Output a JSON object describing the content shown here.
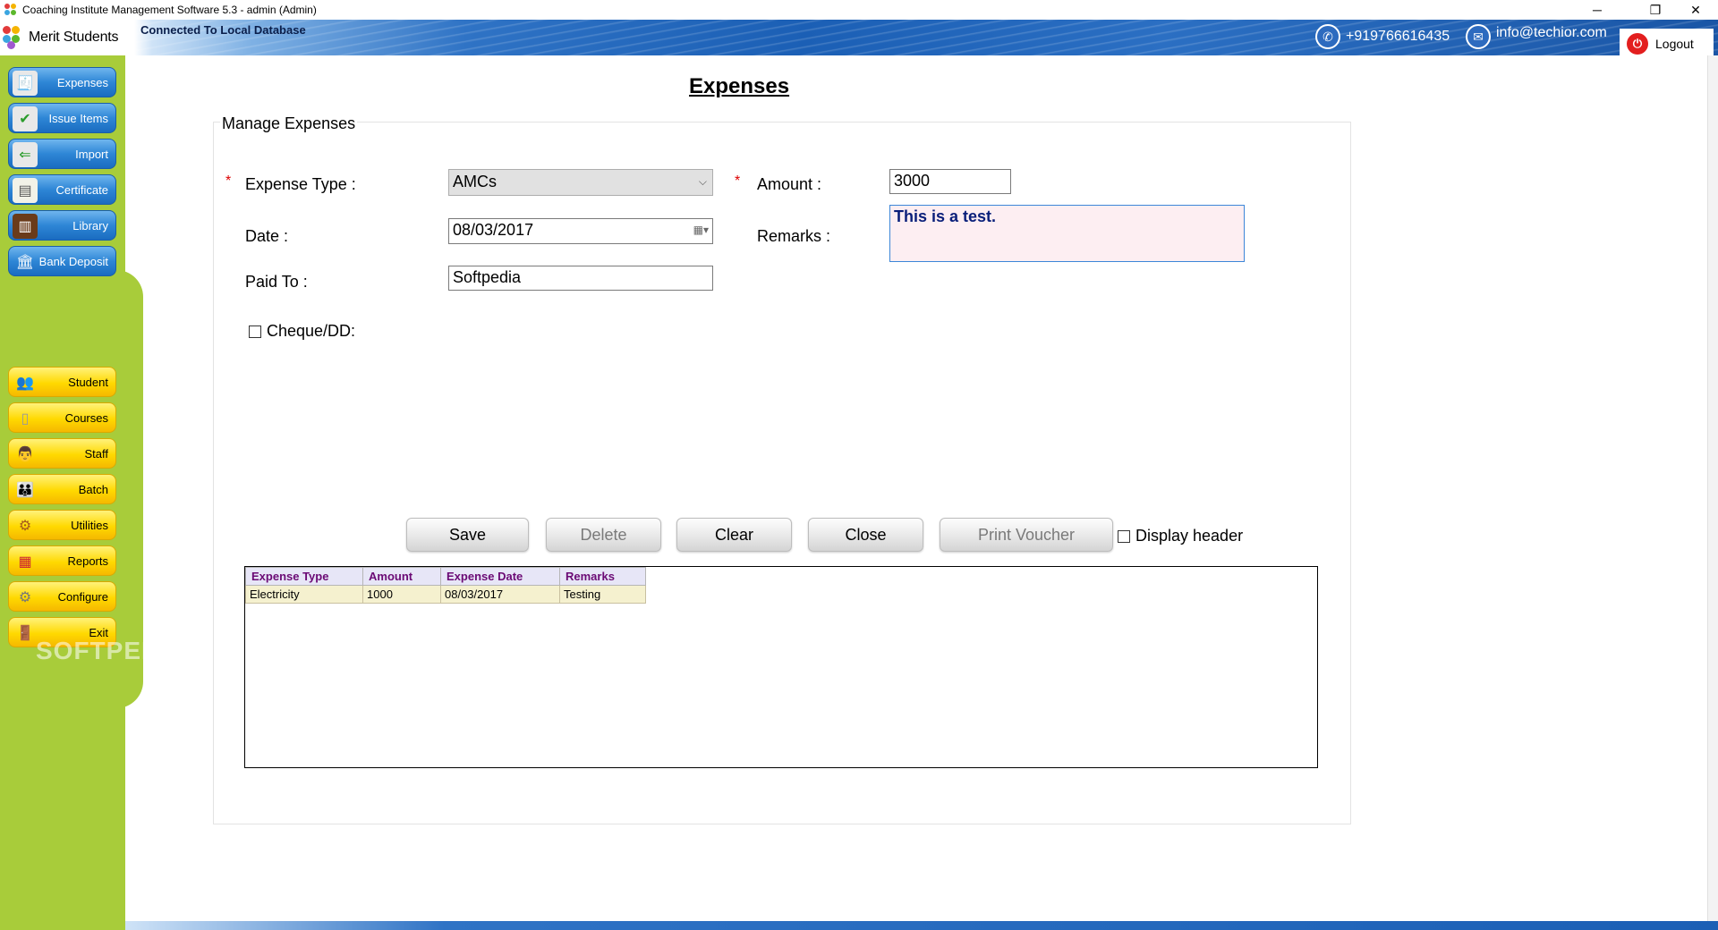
{
  "window": {
    "title": "Coaching Institute Management Software 5.3  -  admin (Admin)",
    "minimize": "─",
    "restore": "❐",
    "close": "✕"
  },
  "header": {
    "connection": "Connected To  Local Database",
    "phone": "+919766616435",
    "email": "info@techior.com",
    "logout": "Logout"
  },
  "brand": {
    "name": "Merit Students"
  },
  "sidebar": {
    "top_items": [
      {
        "label": "Expenses",
        "icon": "receipt-icon"
      },
      {
        "label": "Issue Items",
        "icon": "checklist-icon"
      },
      {
        "label": "Import",
        "icon": "import-icon"
      },
      {
        "label": "Certificate",
        "icon": "certificate-icon"
      },
      {
        "label": "Library",
        "icon": "books-icon"
      },
      {
        "label": "Bank Deposit",
        "icon": "bank-icon"
      }
    ],
    "bottom_items": [
      {
        "label": "Student",
        "icon": "students-icon"
      },
      {
        "label": "Courses",
        "icon": "document-icon"
      },
      {
        "label": "Staff",
        "icon": "staff-icon"
      },
      {
        "label": "Batch",
        "icon": "batch-icon"
      },
      {
        "label": "Utilities",
        "icon": "utilities-icon"
      },
      {
        "label": "Reports",
        "icon": "reports-icon"
      },
      {
        "label": "Configure",
        "icon": "gear-icon"
      },
      {
        "label": "Exit",
        "icon": "exit-door-icon"
      }
    ]
  },
  "page": {
    "title": "Expenses",
    "group_title": "Manage Expenses",
    "required_mark": "*"
  },
  "form": {
    "expense_type_label": "Expense Type :",
    "expense_type_value": "AMCs",
    "amount_label": "Amount :",
    "amount_value": "3000",
    "date_label": "Date :",
    "date_value": "08/03/2017",
    "remarks_label": "Remarks :",
    "remarks_value": "This is a test.",
    "paid_to_label": "Paid To :",
    "paid_to_value": "Softpedia",
    "cheque_label": "Cheque/DD:"
  },
  "buttons": {
    "save": "Save",
    "delete": "Delete",
    "clear": "Clear",
    "close": "Close",
    "print_voucher": "Print Voucher",
    "display_header": "Display header"
  },
  "grid": {
    "columns": [
      "Expense Type",
      "Amount",
      "Expense Date",
      "Remarks"
    ],
    "rows": [
      [
        "Electricity",
        "1000",
        "08/03/2017",
        "Testing"
      ]
    ]
  },
  "watermark": "SOFTPEDIA",
  "colors": {
    "sidebar": "#a8cc3a",
    "nav_blue": "#2e86d6",
    "nav_yellow": "#ffd900",
    "grid_header_text": "#6b0a75",
    "remarks_bg": "#fdeef2"
  }
}
